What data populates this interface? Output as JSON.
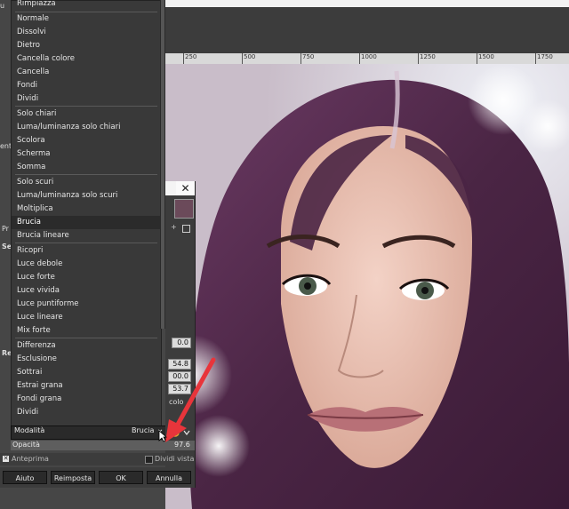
{
  "canvas": {
    "ruler_ticks": [
      "250",
      "500",
      "750",
      "1000",
      "1250",
      "1500",
      "1750"
    ]
  },
  "ghost_panel": {
    "labels": [
      "u",
      "ent",
      "Pr",
      "Se",
      "Re"
    ]
  },
  "menu": {
    "items": [
      {
        "label": "Rimpiazza",
        "active": false
      },
      {
        "label": "Normale",
        "active": false
      },
      {
        "label": "Dissolvi",
        "active": false
      },
      {
        "label": "Dietro",
        "active": false
      },
      {
        "label": "Cancella colore",
        "active": false
      },
      {
        "label": "Cancella",
        "active": false
      },
      {
        "label": "Fondi",
        "active": false
      },
      {
        "label": "Dividi",
        "active": false
      },
      {
        "label": "Solo chiari",
        "active": false
      },
      {
        "label": "Luma/luminanza solo chiari",
        "active": false
      },
      {
        "label": "Scolora",
        "active": false
      },
      {
        "label": "Scherma",
        "active": false
      },
      {
        "label": "Somma",
        "active": false
      },
      {
        "label": "Solo scuri",
        "active": false
      },
      {
        "label": "Luma/luminanza solo scuri",
        "active": false
      },
      {
        "label": "Moltiplica",
        "active": false
      },
      {
        "label": "Brucia",
        "active": true
      },
      {
        "label": "Brucia lineare",
        "active": false
      },
      {
        "label": "Ricopri",
        "active": false
      },
      {
        "label": "Luce debole",
        "active": false
      },
      {
        "label": "Luce forte",
        "active": false
      },
      {
        "label": "Luce vivida",
        "active": false
      },
      {
        "label": "Luce puntiforme",
        "active": false
      },
      {
        "label": "Luce lineare",
        "active": false
      },
      {
        "label": "Mix forte",
        "active": false
      },
      {
        "label": "Differenza",
        "active": false
      },
      {
        "label": "Esclusione",
        "active": false
      },
      {
        "label": "Sottrai",
        "active": false
      },
      {
        "label": "Estrai grana",
        "active": false
      },
      {
        "label": "Fondi grana",
        "active": false
      },
      {
        "label": "Dividi",
        "active": false
      }
    ]
  },
  "dialog": {
    "close_label": "✕",
    "num_fields": [
      "0.0",
      "54.8",
      "00.0",
      "53.7"
    ],
    "partial_label": "colo",
    "mode_label": "Modalità",
    "mode_value": "Brucia",
    "opacity_label": "Opacità",
    "opacity_value": "97.6",
    "preview_label": "Anteprima",
    "split_label": "Dividi vista",
    "buttons": {
      "help": "Aiuto",
      "reset": "Reimposta",
      "ok": "OK",
      "cancel": "Annulla"
    }
  },
  "colors": {
    "arrow": "#e8353b",
    "hair": "#5a2e52",
    "skin": "#e9c2b5",
    "lips": "#b87077"
  }
}
